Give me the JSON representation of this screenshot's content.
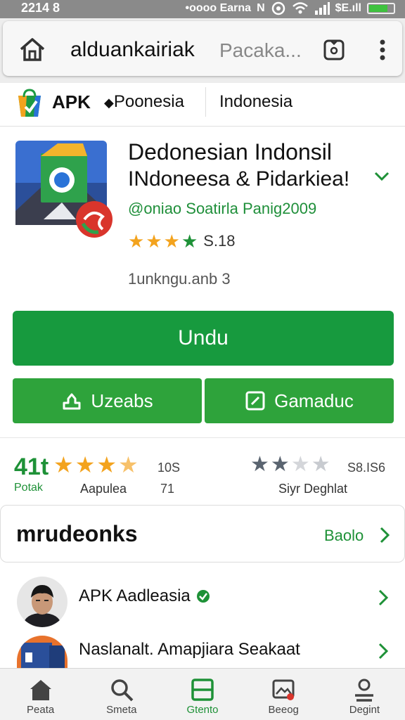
{
  "status_bar": {
    "time": "2214 8",
    "carrier": "•oooo Earna",
    "network": "N",
    "signal_label": "$E.ıll"
  },
  "browser": {
    "domain": "alduankairiak",
    "package_hint": "Pacaka..."
  },
  "site_header": {
    "brand": "APK",
    "region": "Poonesia",
    "country": "Indonesia"
  },
  "app": {
    "title_line1": "Dedonesian Indonsil",
    "title_line2": "INdoneesa & Pidarkiea!",
    "developer": "@oniao Soatirla Panig2009",
    "rating": 4,
    "rating_value": "S.18",
    "meta": "1unkngu.anb 3"
  },
  "actions": {
    "primary": "Undu",
    "secondary_left": "Uzeabs",
    "secondary_right": "Gamaduc"
  },
  "ratings_summary": {
    "score": "41t",
    "score_label": "Potak",
    "left_stars": 3.5,
    "left_count": "10S",
    "left_label": "Aapulea",
    "left_number": "71",
    "right_stars": 2,
    "right_count": "S8.IS6",
    "right_label": "Siyr Deghlat"
  },
  "section": {
    "title": "mrudeonks",
    "more_label": "Baolo"
  },
  "list": [
    {
      "title": "APK Aadleasia",
      "verified": true
    },
    {
      "title": "Naslanalt. Amapjiara Seakaat",
      "verified": false
    }
  ],
  "bottom_nav": [
    {
      "label": "Peata",
      "icon": "home-icon"
    },
    {
      "label": "Smeta",
      "icon": "search-icon"
    },
    {
      "label": "Gtento",
      "icon": "apps-icon",
      "active": true
    },
    {
      "label": "Beeog",
      "icon": "gallery-icon"
    },
    {
      "label": "Degint",
      "icon": "account-icon"
    }
  ],
  "colors": {
    "accent_green": "#179a3e",
    "button_green": "#2ea33b",
    "star_orange": "#f3a31e",
    "star_green": "#1e9137",
    "star_gray": "#5a6470"
  }
}
